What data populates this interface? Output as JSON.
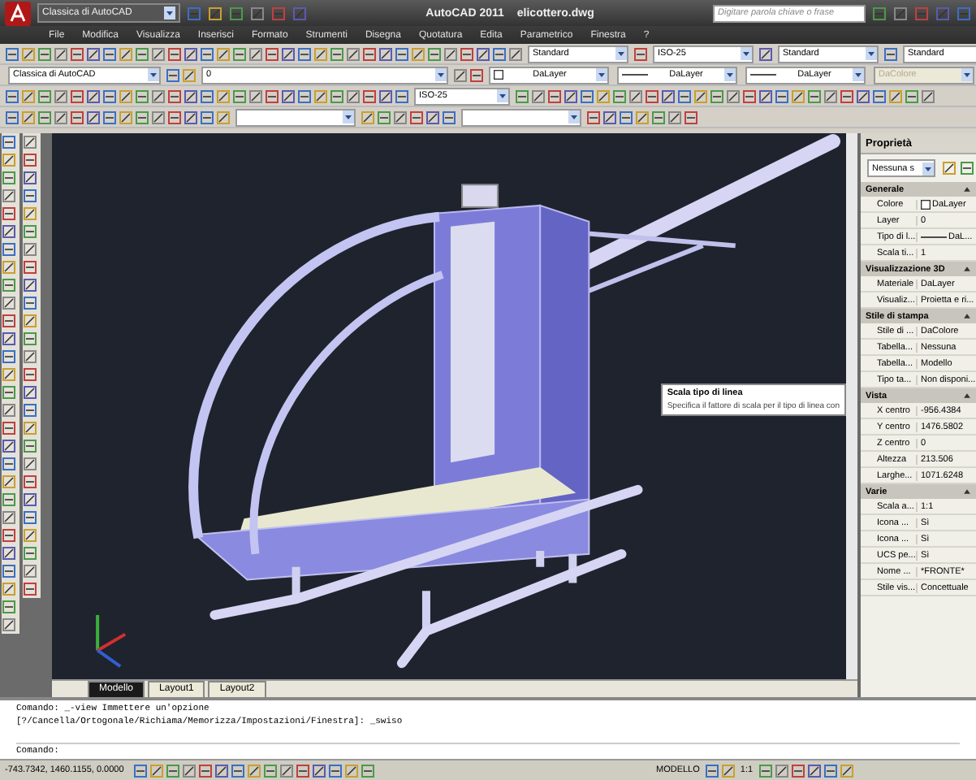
{
  "title_bar": {
    "workspace": "Classica di AutoCAD",
    "title": "AutoCAD 2011",
    "file": "elicottero.dwg",
    "search": {
      "placeholder": "Digitare parola chiave o frase"
    }
  },
  "menu": [
    "File",
    "Modifica",
    "Visualizza",
    "Inserisci",
    "Formato",
    "Strumenti",
    "Disegna",
    "Quotatura",
    "Edita",
    "Parametrico",
    "Finestra",
    "?"
  ],
  "toolbars": {
    "styles": [
      "Standard",
      "ISO-25",
      "Standard",
      "Standard"
    ],
    "workspace": "Classica di AutoCAD",
    "layer": "0",
    "dimstyle": "ISO-25",
    "properties": [
      {
        "value": "DaLayer",
        "kind": "color",
        "disabled": false
      },
      {
        "value": "DaLayer",
        "kind": "line",
        "disabled": false
      },
      {
        "value": "DaLayer",
        "kind": "line",
        "disabled": false
      },
      {
        "value": "DaColore",
        "kind": "plot",
        "disabled": true
      }
    ]
  },
  "tabs": [
    {
      "label": "Modello",
      "selected": true
    },
    {
      "label": "Layout1",
      "selected": false
    },
    {
      "label": "Layout2",
      "selected": false
    }
  ],
  "properties_panel": {
    "title": "Proprietà",
    "selection": "Nessuna s",
    "sections": [
      {
        "name": "Generale",
        "expanded": true,
        "rows": [
          {
            "label": "Colore",
            "value": "DaLayer",
            "kind": "color"
          },
          {
            "label": "Layer",
            "value": "0",
            "kind": "text"
          },
          {
            "label": "Tipo di l...",
            "value": "DaL...",
            "kind": "line"
          },
          {
            "label": "Scala ti...",
            "value": "1",
            "kind": "text"
          }
        ]
      },
      {
        "name": "Visualizzazione 3D",
        "expanded": true,
        "rows": [
          {
            "label": "Materiale",
            "value": "DaLayer",
            "kind": "text"
          },
          {
            "label": "Visualiz...",
            "value": "Proietta e ri...",
            "kind": "text"
          }
        ]
      },
      {
        "name": "Stile di stampa",
        "expanded": true,
        "rows": [
          {
            "label": "Stile di ...",
            "value": "DaColore",
            "kind": "text"
          },
          {
            "label": "Tabella...",
            "value": "Nessuna",
            "kind": "text"
          },
          {
            "label": "Tabella...",
            "value": "Modello",
            "kind": "text"
          },
          {
            "label": "Tipo ta...",
            "value": "Non disponi...",
            "kind": "text"
          }
        ]
      },
      {
        "name": "Vista",
        "expanded": true,
        "rows": [
          {
            "label": "X centro",
            "value": "-956.4384",
            "kind": "text"
          },
          {
            "label": "Y centro",
            "value": "1476.5802",
            "kind": "text"
          },
          {
            "label": "Z centro",
            "value": "0",
            "kind": "text"
          },
          {
            "label": "Altezza",
            "value": "213.506",
            "kind": "text"
          },
          {
            "label": "Larghe...",
            "value": "1071.6248",
            "kind": "text"
          }
        ]
      },
      {
        "name": "Varie",
        "expanded": true,
        "rows": [
          {
            "label": "Scala a...",
            "value": "1:1",
            "kind": "text"
          },
          {
            "label": "Icona ...",
            "value": "Sì",
            "kind": "text"
          },
          {
            "label": "Icona ...",
            "value": "Sì",
            "kind": "text"
          },
          {
            "label": "UCS pe...",
            "value": "Sì",
            "kind": "text"
          },
          {
            "label": "Nome ...",
            "value": "*FRONTE*",
            "kind": "text"
          },
          {
            "label": "Stile vis...",
            "value": "Concettuale",
            "kind": "text"
          }
        ]
      }
    ]
  },
  "tooltip": {
    "title": "Scala tipo di linea",
    "text": "Specifica il fattore di scala per il tipo di linea con"
  },
  "command": {
    "history": [
      "Comando: _-view Immettere un'opzione",
      "[?/Cancella/Ortogonale/Richiama/Memorizza/Impostazioni/Finestra]: _swiso"
    ],
    "prompt": "Comando:"
  },
  "status_bar": {
    "coordinates": "-743.7342, 1460.1155, 0.0000",
    "space": "MODELLO",
    "scale": "1:1"
  }
}
